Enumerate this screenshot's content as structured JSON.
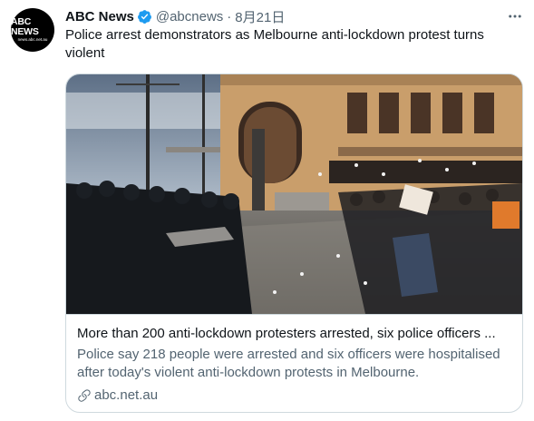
{
  "account": {
    "name": "ABC News",
    "handle": "@abcnews",
    "separator": "·",
    "date": "8月21日",
    "avatar_brand": "ABC NEWS",
    "avatar_sub": "news.abc.net.au"
  },
  "tweet": {
    "text": "Police arrest demonstrators as Melbourne anti-lockdown protest turns violent"
  },
  "card": {
    "title": "More than 200 anti-lockdown protesters arrested, six police officers ...",
    "description": "Police say 218 people were arrested and six officers were hospitalised after today's violent anti-lockdown protests in Melbourne.",
    "domain": "abc.net.au"
  },
  "icons": {
    "verified": "verified-badge-icon",
    "more": "more-options-icon",
    "link": "link-icon"
  },
  "colors": {
    "verified_blue": "#1d9bf0",
    "secondary_text": "#536471",
    "border": "#cfd9de"
  }
}
